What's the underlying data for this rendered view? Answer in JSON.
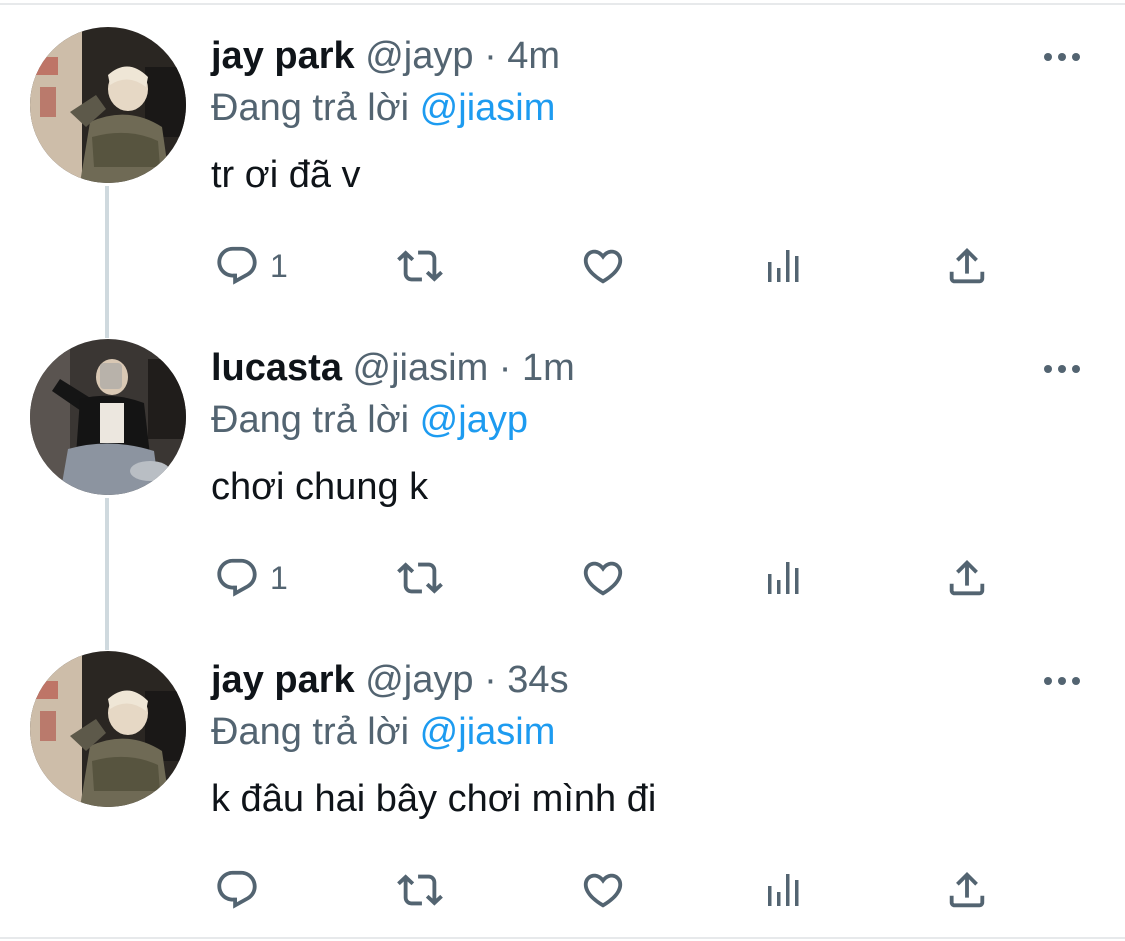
{
  "tweets": [
    {
      "name": "jay park",
      "handle": "@jayp",
      "dot": "·",
      "time": "4m",
      "reply_prefix": "Đang trả lời",
      "reply_to": "@jiasim",
      "text": "tr ơi đã v",
      "reply_count": "1"
    },
    {
      "name": "lucasta",
      "handle": "@jiasim",
      "dot": "·",
      "time": "1m",
      "reply_prefix": "Đang trả lời",
      "reply_to": "@jayp",
      "text": "chơi chung k",
      "reply_count": "1"
    },
    {
      "name": "jay park",
      "handle": "@jayp",
      "dot": "·",
      "time": "34s",
      "reply_prefix": "Đang trả lời",
      "reply_to": "@jiasim",
      "text": "k đâu hai bây chơi mình đi",
      "reply_count": ""
    }
  ],
  "icons": {
    "reply": "speech-bubble-icon",
    "retweet": "retweet-arrows-icon",
    "like": "heart-icon",
    "analytics": "bar-chart-icon",
    "share": "share-upload-icon",
    "more": "three-dots-icon"
  },
  "colors": {
    "text": "#0f1419",
    "secondary": "#536471",
    "mention": "#1d9bf0",
    "thread_line": "#cfd9de",
    "divider": "#e7e9eb"
  }
}
